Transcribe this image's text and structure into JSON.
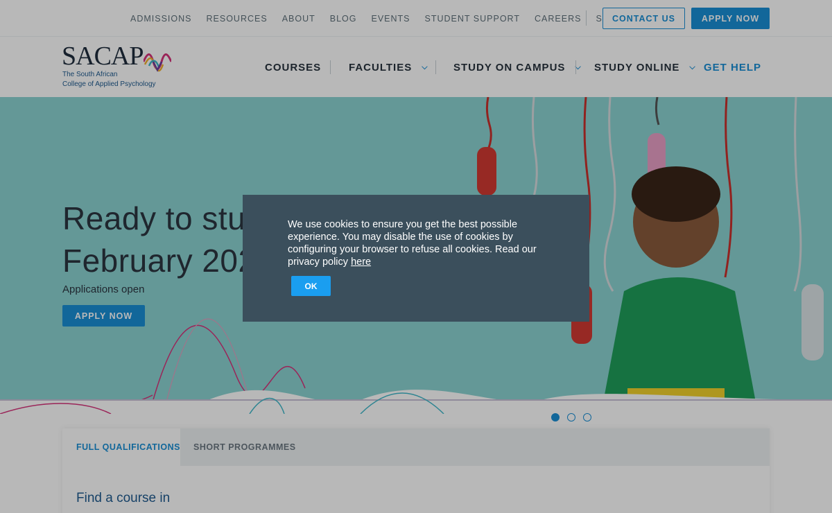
{
  "topbar": {
    "links": [
      "ADMISSIONS",
      "RESOURCES",
      "ABOUT",
      "BLOG",
      "EVENTS",
      "STUDENT SUPPORT",
      "CAREERS",
      "STORE"
    ],
    "contact_label": "CONTACT US",
    "apply_label": "APPLY NOW"
  },
  "logo": {
    "word": "SACAP",
    "line1": "The South African",
    "line2": "College of Applied Psychology"
  },
  "nav": {
    "courses": "COURSES",
    "faculties": "FACULTIES",
    "campus": "STUDY ON CAMPUS",
    "online": "STUDY ONLINE",
    "help": "GET HELP",
    "chevron": "⌵"
  },
  "hero": {
    "title_line1": "Ready to stud",
    "title_line2": "February 202",
    "subtitle": "Applications open",
    "button_label": "APPLY NOW",
    "slides": 3,
    "active_slide": 1
  },
  "tabs": {
    "full": "FULL QUALIFICATIONS",
    "short": "SHORT PROGRAMMES",
    "find_text": "Find a course in"
  },
  "cookie": {
    "text": "We use cookies to ensure you get the best possible experience. You may disable the use of cookies by configuring your browser to refuse all cookies. Read our privacy policy ",
    "link_text": "here",
    "ok_label": "OK"
  },
  "colors": {
    "accent": "#1a8fd6",
    "hero_bg": "#8bd3d2",
    "dialog_bg": "#3b4f5c",
    "wave_pink": "#d6327a",
    "wave_teal": "#3fb8c9"
  }
}
